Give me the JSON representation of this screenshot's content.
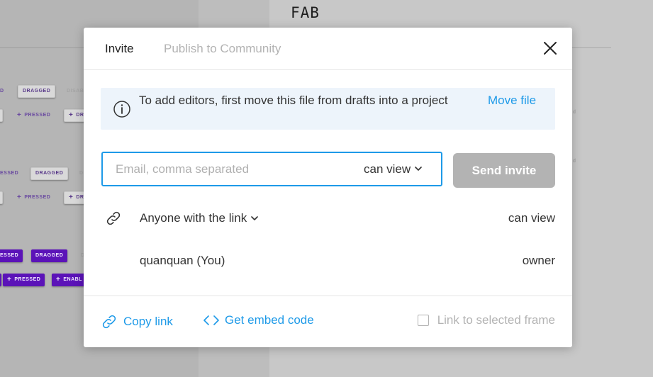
{
  "canvas": {
    "title": "FAB",
    "chips": [
      {
        "label": "D",
        "style": "flat"
      },
      {
        "label": "DRAGGED",
        "style": "light"
      },
      {
        "label": "DISABL",
        "style": "flat-muted"
      },
      {
        "label": "PRESSED",
        "style": "flat"
      },
      {
        "label": "DR",
        "style": "light"
      },
      {
        "label": "ESSED",
        "style": "flat"
      },
      {
        "label": "DRAGGED",
        "style": "light"
      },
      {
        "label": "DI",
        "style": "flat-muted"
      },
      {
        "label": "PRESSED",
        "style": "flat"
      },
      {
        "label": "DR",
        "style": "light"
      },
      {
        "label": "ESSED",
        "style": "dark"
      },
      {
        "label": "DRAGGED",
        "style": "dark"
      },
      {
        "label": "D",
        "style": "flat-muted"
      },
      {
        "label": "PRESSED",
        "style": "dark"
      },
      {
        "label": "ENABL",
        "style": "dark"
      }
    ],
    "side_marks": [
      "d",
      "d"
    ]
  },
  "modal": {
    "tabs": [
      {
        "label": "Invite",
        "active": true
      },
      {
        "label": "Publish to Community",
        "active": false
      }
    ],
    "close_icon": "close-icon",
    "banner": {
      "icon": "info-icon",
      "text": "To add editors, first move this file from drafts into a project",
      "link": "Move file"
    },
    "invite": {
      "placeholder": "Email, comma separated",
      "value": "",
      "permission": "can view",
      "send_label": "Send invite"
    },
    "share_rows": [
      {
        "icon": "link-icon",
        "label": "Anyone with the link",
        "permission": "can view"
      },
      {
        "label": "quanquan (You)",
        "permission": "owner"
      }
    ],
    "footer": {
      "copy_link": "Copy link",
      "embed_code": "Get embed code",
      "frame_option": "Link to selected frame",
      "frame_checked": false
    }
  },
  "colors": {
    "accent": "#1e9ae8",
    "disabled_button": "#b3b3b3",
    "banner_bg": "#edf4fb",
    "chip_purple": "#5b13b8"
  }
}
